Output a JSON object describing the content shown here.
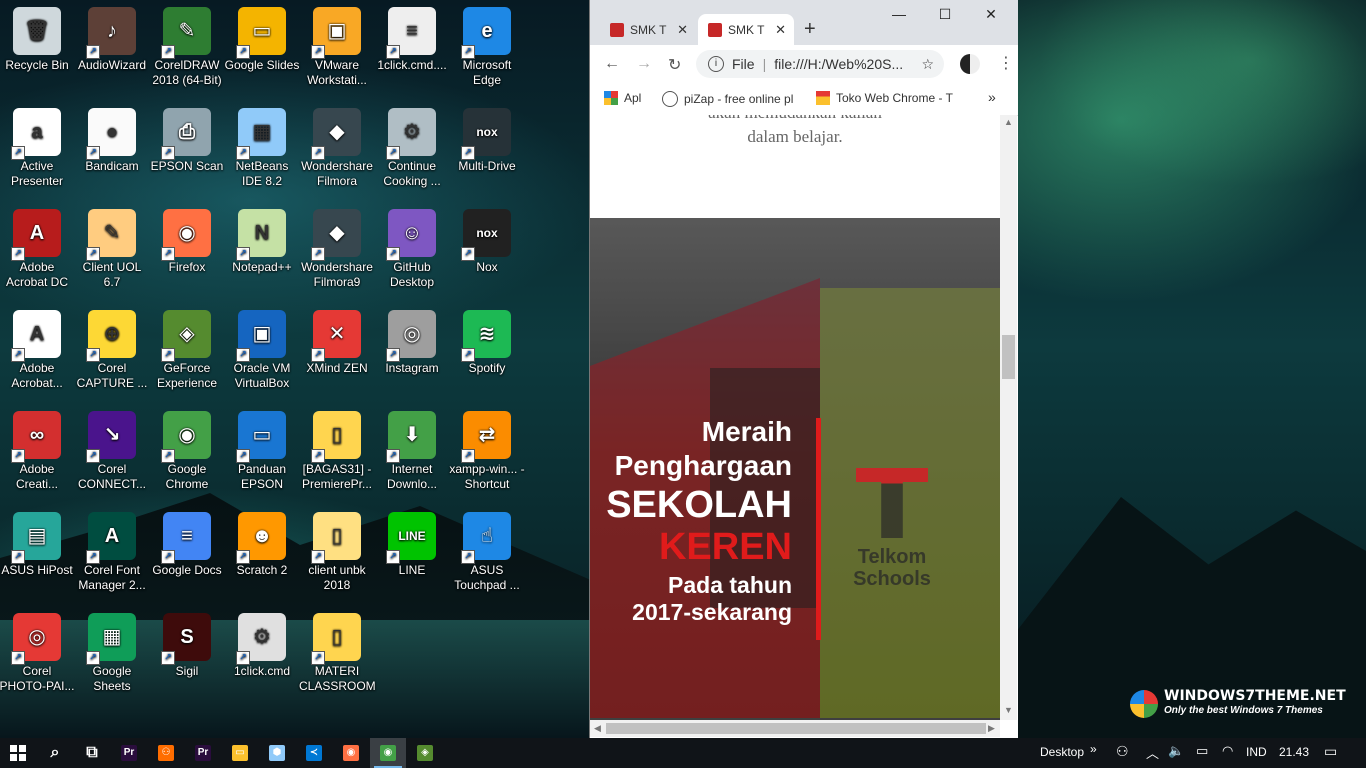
{
  "desktop": {
    "icons": [
      {
        "label": "Recycle Bin",
        "name": "recycle-bin-icon",
        "color": "#cfd8dc",
        "glyph": "🗑"
      },
      {
        "label": "AudioWizard",
        "name": "audiowizard-icon",
        "color": "#5d4037",
        "glyph": "♪"
      },
      {
        "label": "CorelDRAW 2018 (64-Bit)",
        "name": "coreldraw-icon",
        "color": "#2e7d32",
        "glyph": "✎"
      },
      {
        "label": "Google Slides",
        "name": "google-slides-icon",
        "color": "#f4b400",
        "glyph": "▭"
      },
      {
        "label": "VMware Workstati...",
        "name": "vmware-icon",
        "color": "#f9a825",
        "glyph": "▣"
      },
      {
        "label": "1click.cmd....",
        "name": "cmd-file-icon",
        "color": "#eeeeee",
        "glyph": "≡"
      },
      {
        "label": "Microsoft Edge",
        "name": "edge-icon",
        "color": "#1e88e5",
        "glyph": "e"
      },
      {
        "label": "Active Presenter",
        "name": "active-presenter-icon",
        "color": "#ffffff",
        "glyph": "a"
      },
      {
        "label": "Bandicam",
        "name": "bandicam-icon",
        "color": "#fafafa",
        "glyph": "●"
      },
      {
        "label": "EPSON Scan",
        "name": "epson-scan-icon",
        "color": "#90a4ae",
        "glyph": "⎙"
      },
      {
        "label": "NetBeans IDE 8.2",
        "name": "netbeans-icon",
        "color": "#90caf9",
        "glyph": "▦"
      },
      {
        "label": "Wondershare Filmora",
        "name": "filmora-icon",
        "color": "#37474f",
        "glyph": "◆"
      },
      {
        "label": "Continue Cooking ...",
        "name": "installer-icon",
        "color": "#b0bec5",
        "glyph": "⚙"
      },
      {
        "label": "Multi-Drive",
        "name": "nox-multidrive-icon",
        "color": "#263238",
        "glyph": "nox"
      },
      {
        "label": "Adobe Acrobat DC",
        "name": "acrobat-dc-icon",
        "color": "#b71c1c",
        "glyph": "A"
      },
      {
        "label": "Client UOL 6.7",
        "name": "client-uol-icon",
        "color": "#ffcc80",
        "glyph": "✎"
      },
      {
        "label": "Firefox",
        "name": "firefox-icon",
        "color": "#ff7043",
        "glyph": "◉"
      },
      {
        "label": "Notepad++",
        "name": "notepadpp-icon",
        "color": "#c5e1a5",
        "glyph": "N"
      },
      {
        "label": "Wondershare Filmora9",
        "name": "filmora9-icon",
        "color": "#37474f",
        "glyph": "◆"
      },
      {
        "label": "GitHub Desktop",
        "name": "github-desktop-icon",
        "color": "#7e57c2",
        "glyph": "☺"
      },
      {
        "label": "Nox",
        "name": "nox-icon",
        "color": "#212121",
        "glyph": "nox"
      },
      {
        "label": "Adobe Acrobat...",
        "name": "adobe-acrobat-icon",
        "color": "#ffffff",
        "glyph": "A"
      },
      {
        "label": "Corel CAPTURE ...",
        "name": "corel-capture-icon",
        "color": "#fdd835",
        "glyph": "⊕"
      },
      {
        "label": "GeForce Experience",
        "name": "geforce-icon",
        "color": "#558b2f",
        "glyph": "◈"
      },
      {
        "label": "Oracle VM VirtualBox",
        "name": "virtualbox-icon",
        "color": "#1565c0",
        "glyph": "▣"
      },
      {
        "label": "XMind ZEN",
        "name": "xmind-icon",
        "color": "#e53935",
        "glyph": "✕"
      },
      {
        "label": "Instagram",
        "name": "instagram-icon",
        "color": "#9e9e9e",
        "glyph": "◎"
      },
      {
        "label": "Spotify",
        "name": "spotify-icon",
        "color": "#1db954",
        "glyph": "≋"
      },
      {
        "label": "Adobe Creati...",
        "name": "creative-cloud-icon",
        "color": "#d32f2f",
        "glyph": "∞"
      },
      {
        "label": "Corel CONNECT...",
        "name": "corel-connect-icon",
        "color": "#4a148c",
        "glyph": "↘"
      },
      {
        "label": "Google Chrome",
        "name": "chrome-icon",
        "color": "#43a047",
        "glyph": "◉"
      },
      {
        "label": "Panduan EPSON",
        "name": "epson-guide-icon",
        "color": "#1976d2",
        "glyph": "▭"
      },
      {
        "label": "[BAGAS31] - PremierePr...",
        "name": "folder-premiere-icon",
        "color": "#ffd54f",
        "glyph": "▯"
      },
      {
        "label": "Internet Downlo...",
        "name": "idm-icon",
        "color": "#43a047",
        "glyph": "⬇"
      },
      {
        "label": "xampp-win... - Shortcut",
        "name": "xampp-icon",
        "color": "#fb8c00",
        "glyph": "⇄"
      },
      {
        "label": "ASUS HiPost",
        "name": "asus-hipost-icon",
        "color": "#26a69a",
        "glyph": "▤"
      },
      {
        "label": "Corel Font Manager 2...",
        "name": "corel-font-manager-icon",
        "color": "#004d40",
        "glyph": "A"
      },
      {
        "label": "Google Docs",
        "name": "google-docs-icon",
        "color": "#4285f4",
        "glyph": "≡"
      },
      {
        "label": "Scratch 2",
        "name": "scratch-icon",
        "color": "#ff9800",
        "glyph": "☻"
      },
      {
        "label": "client unbk 2018",
        "name": "folder-unbk-icon",
        "color": "#ffe082",
        "glyph": "▯"
      },
      {
        "label": "LINE",
        "name": "line-icon",
        "color": "#00c300",
        "glyph": "LINE"
      },
      {
        "label": "ASUS Touchpad ...",
        "name": "asus-touchpad-icon",
        "color": "#1e88e5",
        "glyph": "☝"
      },
      {
        "label": "Corel PHOTO-PAI...",
        "name": "corel-photopaint-icon",
        "color": "#e53935",
        "glyph": "◎"
      },
      {
        "label": "Google Sheets",
        "name": "google-sheets-icon",
        "color": "#0f9d58",
        "glyph": "▦"
      },
      {
        "label": "Sigil",
        "name": "sigil-icon",
        "color": "#3e0b0b",
        "glyph": "S"
      },
      {
        "label": "1click.cmd",
        "name": "cmd-file-2-icon",
        "color": "#e0e0e0",
        "glyph": "⚙"
      },
      {
        "label": "MATERI CLASSROOM",
        "name": "folder-materi-icon",
        "color": "#ffd54f",
        "glyph": "▯"
      }
    ]
  },
  "browser": {
    "tabs": [
      {
        "title": "SMK T"
      },
      {
        "title": "SMK T"
      }
    ],
    "new_tab": "+",
    "controls": {
      "minimize": "—",
      "maximize": "☐",
      "close": "✕"
    },
    "nav": {
      "back": "←",
      "forward": "→",
      "reload": "↻"
    },
    "omnibox": {
      "label": "File",
      "url": "file:///H:/Web%20S..."
    },
    "bookmarks": [
      {
        "label": "Apl",
        "color": "#e53935"
      },
      {
        "label": "piZap - free online pl",
        "color": "#555555"
      },
      {
        "label": "Toko Web Chrome - T",
        "color": "#e53935"
      }
    ],
    "bookmarks_more": "»",
    "content": {
      "text_line1": "akan memudahkan kalian",
      "text_line2": "dalam belajar.",
      "hero": {
        "line1": "Meraih",
        "line2": "Penghargaan",
        "line3": "SEKOLAH",
        "line4": "KEREN",
        "line5": "Pada tahun",
        "line6": "2017-sekarang",
        "logo_line1": "Telkom",
        "logo_line2": "Schools"
      }
    }
  },
  "watermark": {
    "title": "WINDOWS7THEME.NET",
    "subtitle": "Only the best Windows 7 Themes"
  },
  "taskbar": {
    "apps": [
      {
        "name": "search-icon",
        "glyph": "⌕",
        "color": "#101418"
      },
      {
        "name": "task-view-icon",
        "glyph": "⧉",
        "color": "#101418"
      },
      {
        "name": "premiere-icon",
        "glyph": "Pr",
        "color": "#2a0d3d"
      },
      {
        "name": "bandicam-taskbar-icon",
        "glyph": "⚇",
        "color": "#ff6d00"
      },
      {
        "name": "premiere-2-icon",
        "glyph": "Pr",
        "color": "#2a0d3d"
      },
      {
        "name": "file-explorer-icon",
        "glyph": "▭",
        "color": "#fbc02d"
      },
      {
        "name": "3d-viewer-icon",
        "glyph": "⬢",
        "color": "#90caf9"
      },
      {
        "name": "vscode-icon",
        "glyph": "≺",
        "color": "#0078d4"
      },
      {
        "name": "firefox-taskbar-icon",
        "glyph": "◉",
        "color": "#ff7043"
      },
      {
        "name": "chrome-taskbar-icon",
        "glyph": "◉",
        "color": "#43a047"
      },
      {
        "name": "geforce-taskbar-icon",
        "glyph": "◈",
        "color": "#558b2f"
      }
    ],
    "desktop_label": "Desktop",
    "more": "»",
    "language": "IND",
    "time": "21.43"
  }
}
